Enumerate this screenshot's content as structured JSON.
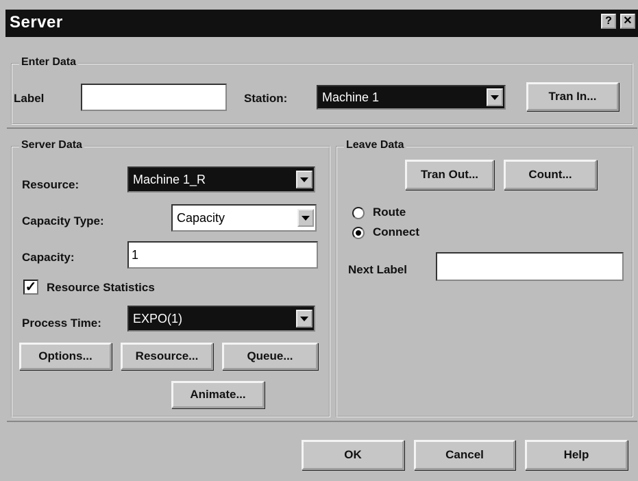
{
  "window": {
    "title": "Server",
    "help_glyph": "?",
    "close_glyph": "✕"
  },
  "enter_data": {
    "group_label": "Enter Data",
    "label_label": "Label",
    "label_value": "",
    "station_label": "Station:",
    "station_value": "Machine 1",
    "tran_in_button": "Tran In..."
  },
  "server_data": {
    "group_label": "Server Data",
    "resource_label": "Resource:",
    "resource_value": "Machine 1_R",
    "capacity_type_label": "Capacity Type:",
    "capacity_type_value": "Capacity",
    "capacity_label": "Capacity:",
    "capacity_value": "1",
    "resource_statistics_label": "Resource Statistics",
    "resource_statistics_checked": true,
    "process_time_label": "Process Time:",
    "process_time_value": "EXPO(1)",
    "options_button": "Options...",
    "resource_button": "Resource...",
    "queue_button": "Queue...",
    "animate_button": "Animate..."
  },
  "leave_data": {
    "group_label": "Leave Data",
    "tran_out_button": "Tran Out...",
    "count_button": "Count...",
    "route_label": "Route",
    "connect_label": "Connect",
    "selected": "Connect",
    "next_label_label": "Next Label",
    "next_label_value": ""
  },
  "footer": {
    "ok_button": "OK",
    "cancel_button": "Cancel",
    "help_button": "Help"
  }
}
